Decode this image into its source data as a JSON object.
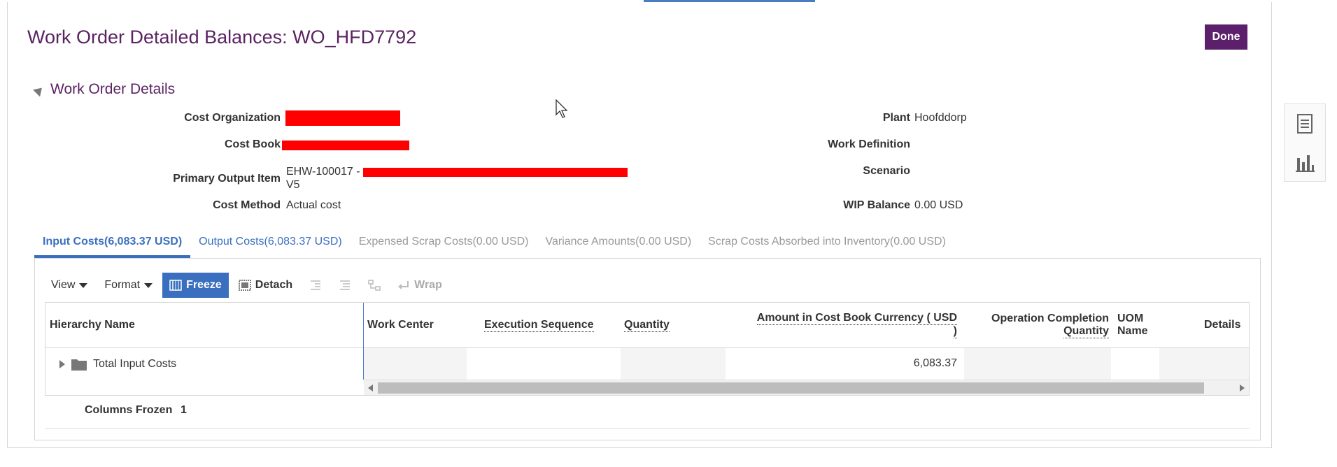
{
  "page": {
    "title": "Work Order Detailed Balances: WO_HFD7792",
    "done_label": "Done"
  },
  "section": {
    "title": "Work Order Details"
  },
  "fields": {
    "cost_org_label": "Cost Organization",
    "cost_book_label": "Cost Book",
    "primary_output_label": "Primary Output Item",
    "primary_output_value_1": "EHW-100017 -",
    "primary_output_value_2": "V5",
    "cost_method_label": "Cost Method",
    "cost_method_value": "Actual cost",
    "plant_label": "Plant",
    "plant_value": "Hoofddorp",
    "work_definition_label": "Work Definition",
    "scenario_label": "Scenario",
    "wip_balance_label": "WIP Balance",
    "wip_balance_value": "0.00 USD"
  },
  "tabs": [
    {
      "label": "Input Costs(6,083.37 USD)"
    },
    {
      "label": "Output Costs(6,083.37 USD)"
    },
    {
      "label": "Expensed Scrap Costs(0.00 USD)"
    },
    {
      "label": "Variance Amounts(0.00 USD)"
    },
    {
      "label": "Scrap Costs Absorbed into Inventory(0.00 USD)"
    }
  ],
  "toolbar": {
    "view_label": "View",
    "format_label": "Format",
    "freeze_label": "Freeze",
    "detach_label": "Detach",
    "wrap_label": "Wrap"
  },
  "table": {
    "headers": {
      "hierarchy_name": "Hierarchy Name",
      "work_center": "Work Center",
      "execution_sequence": "Execution Sequence",
      "quantity": "Quantity",
      "amount_line1": "Amount in Cost Book Currency ( USD",
      "amount_line2": ")",
      "op_completion_line1": "Operation Completion",
      "op_completion_line2": "Quantity",
      "uom_line1": "UOM",
      "uom_line2": "Name",
      "details": "Details"
    },
    "rows": [
      {
        "hierarchy_name": "Total Input Costs",
        "amount": "6,083.37"
      }
    ]
  },
  "footer": {
    "columns_frozen_label": "Columns Frozen",
    "columns_frozen_value": "1"
  },
  "colors": {
    "title": "#5b2362",
    "done_button": "#5b1f6b",
    "accent": "#3a6fc0",
    "redaction": "#ff0000"
  }
}
